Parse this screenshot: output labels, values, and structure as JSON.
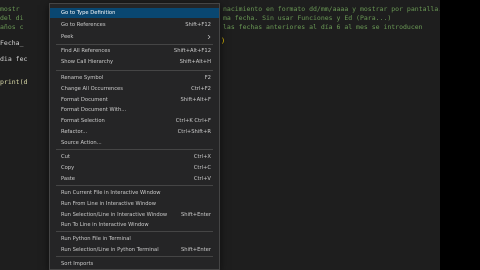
{
  "editor": {
    "lines": [
      {
        "left": "mostr",
        "left_style": "comment",
        "right": "nacimiento en formato dd/mm/aaaa y mostrar por pantalla..."
      },
      {
        "left": "del di",
        "left_style": "comment",
        "right": "ma fecha. Sin usar Funciones y Ed (Para...) "
      },
      {
        "left": "años c",
        "left_style": "comment",
        "right": "las fechas anteriores al día 6 al mes se introducen"
      },
      {
        "left": "",
        "left_style": "",
        "right": ""
      },
      {
        "left": "Fecha_",
        "left_style": "",
        "right": ""
      },
      {
        "left": "",
        "left_style": "",
        "right": ""
      },
      {
        "left": "dia fec",
        "left_style": "",
        "right": ""
      },
      {
        "left": "",
        "left_style": "",
        "right": ""
      },
      {
        "left": "print(d",
        "left_style": "fn",
        "right": ""
      }
    ],
    "bracket_glyph": ")"
  },
  "context_menu": {
    "items": [
      {
        "label": "Go to Type Definition",
        "shortcut": ""
      },
      {
        "label": "Go to References",
        "shortcut": "Shift+F12"
      },
      {
        "label": "Peek",
        "shortcut": "",
        "submenu": true
      },
      {
        "label": "Find All References",
        "shortcut": "Shift+Alt+F12"
      },
      {
        "label": "Show Call Hierarchy",
        "shortcut": "Shift+Alt+H"
      },
      {
        "label": "Rename Symbol",
        "shortcut": "F2"
      },
      {
        "label": "Change All Occurrences",
        "shortcut": "Ctrl+F2"
      },
      {
        "label": "Format Document",
        "shortcut": "Shift+Alt+F"
      },
      {
        "label": "Format Document With...",
        "shortcut": ""
      },
      {
        "label": "Format Selection",
        "shortcut": "Ctrl+K Ctrl+F"
      },
      {
        "label": "Refactor...",
        "shortcut": "Ctrl+Shift+R"
      },
      {
        "label": "Source Action...",
        "shortcut": ""
      },
      {
        "label": "Cut",
        "shortcut": "Ctrl+X"
      },
      {
        "label": "Copy",
        "shortcut": "Ctrl+C"
      },
      {
        "label": "Paste",
        "shortcut": "Ctrl+V"
      },
      {
        "label": "Run Current File in Interactive Window",
        "shortcut": ""
      },
      {
        "label": "Run From Line in Interactive Window",
        "shortcut": ""
      },
      {
        "label": "Run Selection/Line in Interactive Window",
        "shortcut": "Shift+Enter"
      },
      {
        "label": "Run To Line in Interactive Window",
        "shortcut": ""
      },
      {
        "label": "Run Python File in Terminal",
        "shortcut": ""
      },
      {
        "label": "Run Selection/Line in Python Terminal",
        "shortcut": "Shift+Enter"
      },
      {
        "label": "Sort Imports",
        "shortcut": ""
      }
    ],
    "highlighted_index": 0,
    "colors": {
      "background": "#252526",
      "highlight": "#094771",
      "text": "#cccccc"
    }
  }
}
